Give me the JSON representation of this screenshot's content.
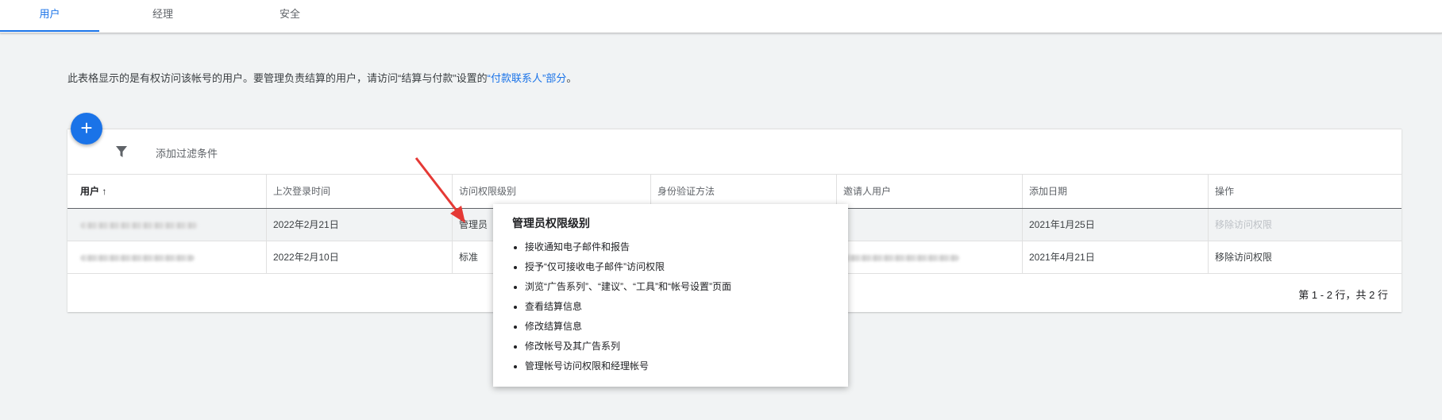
{
  "tabs": [
    {
      "label": "用户",
      "active": true
    },
    {
      "label": "经理",
      "active": false
    },
    {
      "label": "安全",
      "active": false
    }
  ],
  "intro": {
    "text": "此表格显示的是有权访问该帐号的用户。要管理负责结算的用户，请访问“结算与付款”设置的",
    "link": "“付款联系人”部分",
    "suffix": "。"
  },
  "toolbar": {
    "add_icon": "plus-icon",
    "filter_icon": "filter-icon",
    "filter_label": "添加过滤条件"
  },
  "table": {
    "headers": [
      "用户 ↑",
      "上次登录时间",
      "访问权限级别",
      "身份验证方法",
      "邀请人用户",
      "添加日期",
      "操作"
    ],
    "rows": [
      {
        "user": "",
        "last_login": "2022年2月21日",
        "access": "管理员",
        "auth": "",
        "inviter": "",
        "added": "2021年1月25日",
        "action": "移除访问权限",
        "action_disabled": true
      },
      {
        "user": "",
        "last_login": "2022年2月10日",
        "access": "标准",
        "auth": "",
        "inviter": "",
        "added": "2021年4月21日",
        "action": "移除访问权限",
        "action_disabled": false
      }
    ],
    "pagination": "第 1 - 2 行，共 2 行"
  },
  "popover": {
    "title": "管理员权限级别",
    "items": [
      "接收通知电子邮件和报告",
      "授予“仅可接收电子邮件”访问权限",
      "浏览“广告系列”、“建议”、“工具”和“帐号设置”页面",
      "查看结算信息",
      "修改结算信息",
      "修改帐号及其广告系列",
      "管理帐号访问权限和经理帐号"
    ]
  },
  "colors": {
    "accent": "#1a73e8",
    "arrow": "#e53935"
  }
}
